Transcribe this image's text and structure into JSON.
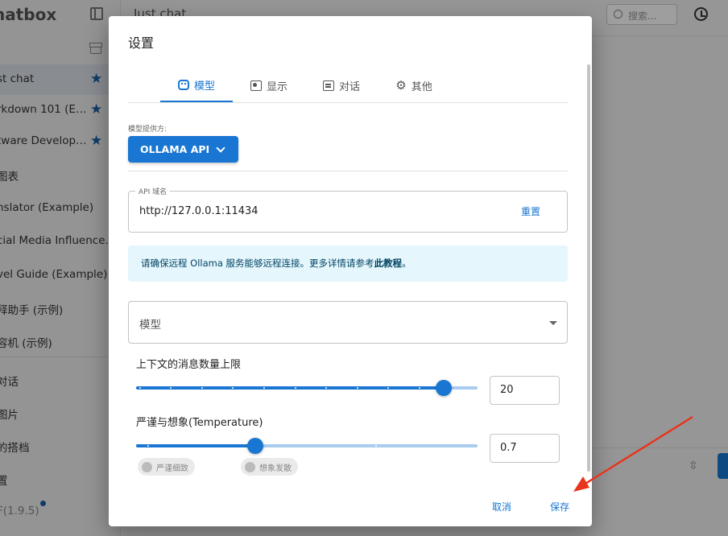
{
  "app": {
    "brand": "hatbox",
    "sessions": [
      {
        "label": "st chat",
        "starred": true,
        "active": true
      },
      {
        "label": "rkdown 101 (E…",
        "starred": true
      },
      {
        "label": "tware Develop…",
        "starred": true
      },
      {
        "label": "图表"
      },
      {
        "label": "nslator (Example)"
      },
      {
        "label": "cial Media Influence…"
      },
      {
        "label": "vel Guide (Example)"
      },
      {
        "label": "释助手 (示例)"
      },
      {
        "label": "容机 (示例)"
      }
    ],
    "nav": [
      "对话",
      "图片",
      "的搭档",
      "置"
    ],
    "version": "F(1.9.5)",
    "main_title": "Just chat",
    "search_placeholder": "搜索..."
  },
  "dialog": {
    "title": "设置",
    "tabs": [
      {
        "label": "模型",
        "icon": "robot-icon",
        "active": true
      },
      {
        "label": "显示",
        "icon": "display-icon"
      },
      {
        "label": "对话",
        "icon": "chat-icon"
      },
      {
        "label": "其他",
        "icon": "gear-icon"
      }
    ],
    "provider_label": "模型提供方:",
    "provider_value": "OLLAMA API",
    "api_label": "API 域名",
    "api_value": "http://127.0.0.1:11434",
    "reset_label": "重置",
    "info_text": "请确保远程 Ollama 服务能够远程连接。更多详情请参考",
    "info_link": "此教程",
    "info_end": "。",
    "model_placeholder": "模型",
    "context_label": "上下文的消息数量上限",
    "context_value": "20",
    "context_fraction": 0.9,
    "context_marks": 11,
    "temperature_label": "严谨与想象(Temperature)",
    "temperature_value": "0.7",
    "temperature_fraction": 0.35,
    "temperature_marks": 3,
    "chip_strict": "严谨细致",
    "chip_imagine": "想象发散",
    "cancel_label": "取消",
    "save_label": "保存"
  },
  "colors": {
    "accent": "#1976d2",
    "annotation_arrow": "#e8341c",
    "info_bg": "#e5f6fd"
  }
}
